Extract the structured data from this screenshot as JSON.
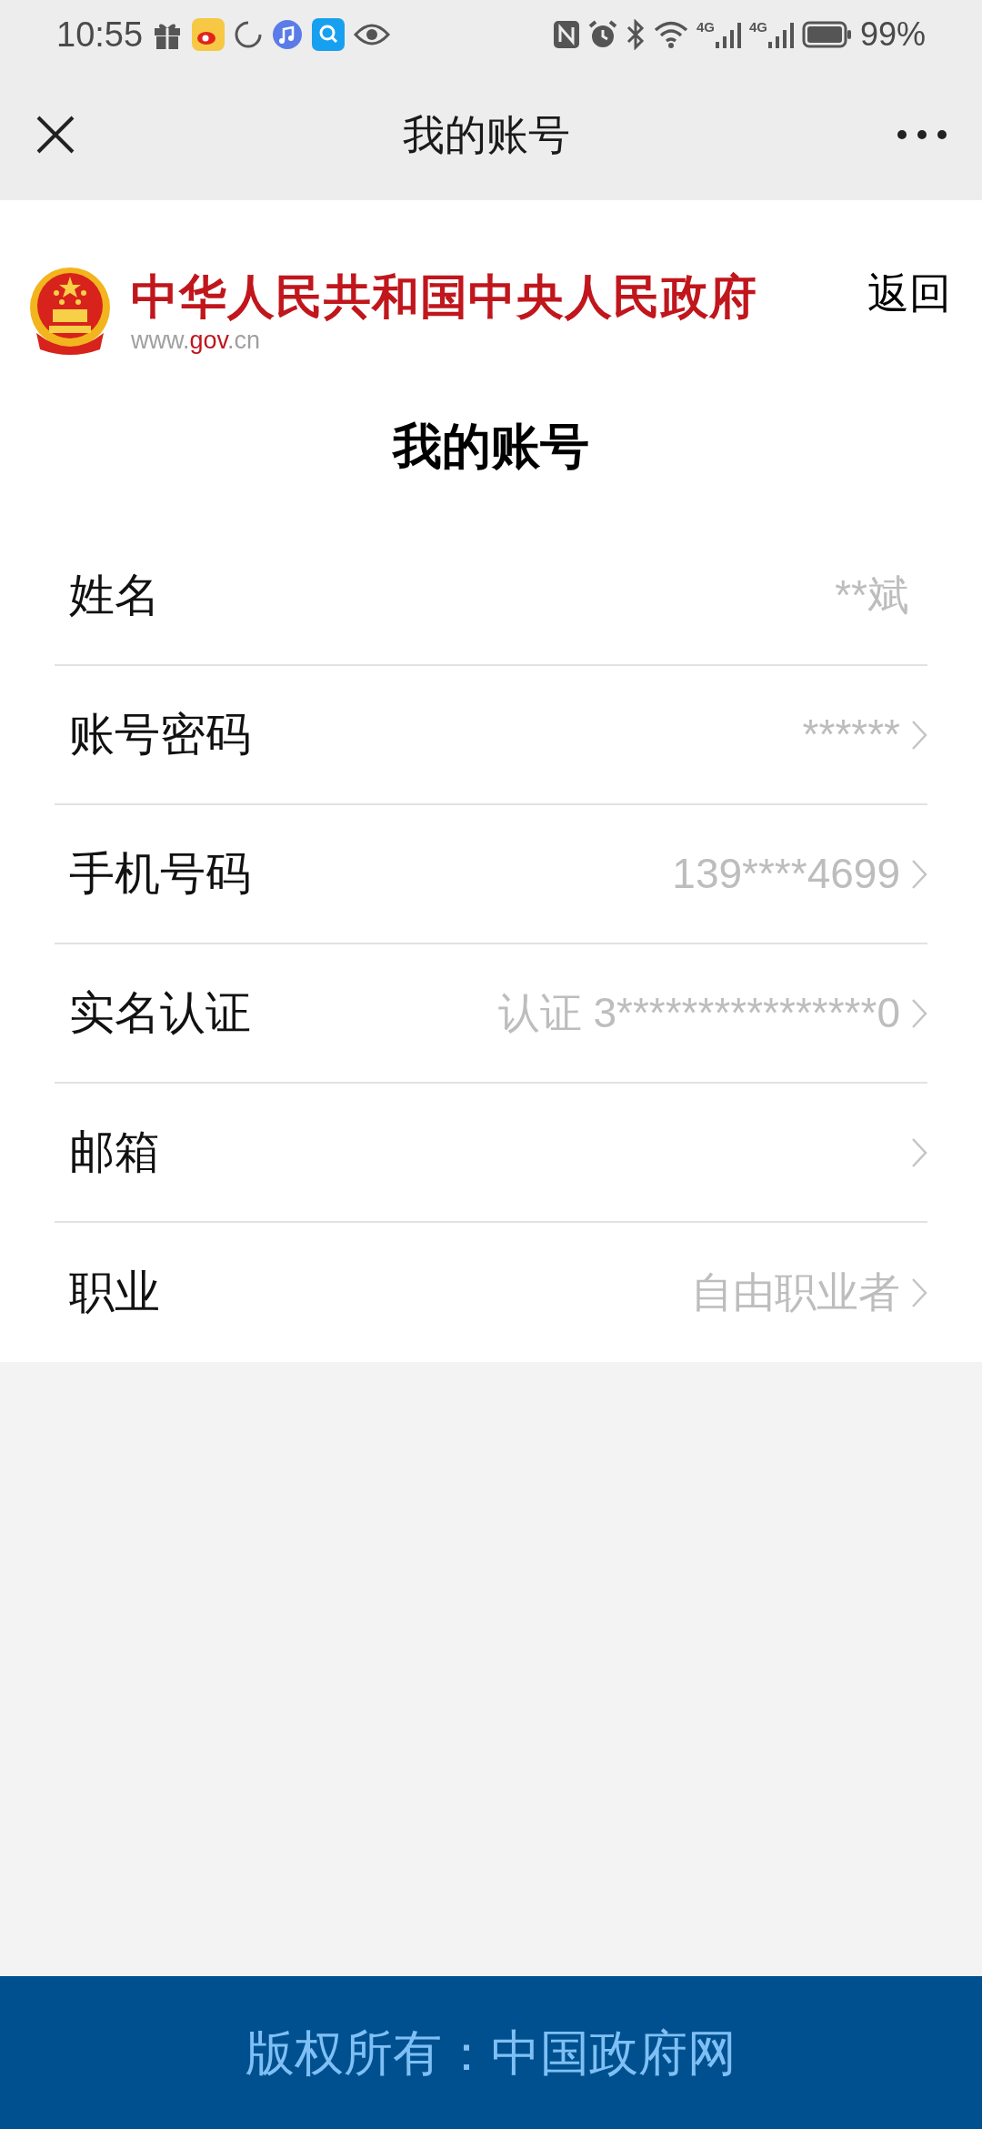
{
  "status_bar": {
    "time": "10:55",
    "battery": "99%",
    "network_labels": [
      "4G",
      "4G"
    ]
  },
  "nav": {
    "title": "我的账号"
  },
  "site_header": {
    "title": "中华人民共和国中央人民政府",
    "url_parts": [
      {
        "text": "www.",
        "highlight": false
      },
      {
        "text": "gov",
        "highlight": true
      },
      {
        "text": ".cn",
        "highlight": false
      }
    ],
    "back": "返回"
  },
  "heading": "我的账号",
  "rows": [
    {
      "label": "姓名",
      "value": "**斌",
      "chevron": false
    },
    {
      "label": "账号密码",
      "value": "******",
      "chevron": true
    },
    {
      "label": "手机号码",
      "value": "139****4699",
      "chevron": true
    },
    {
      "label": "实名认证",
      "value": "认证 3****************0",
      "chevron": true
    },
    {
      "label": "邮箱",
      "chevron": true
    },
    {
      "label": "职业",
      "value": "自由职业者",
      "chevron": true
    }
  ],
  "footer": "版权所有：中国政府网"
}
